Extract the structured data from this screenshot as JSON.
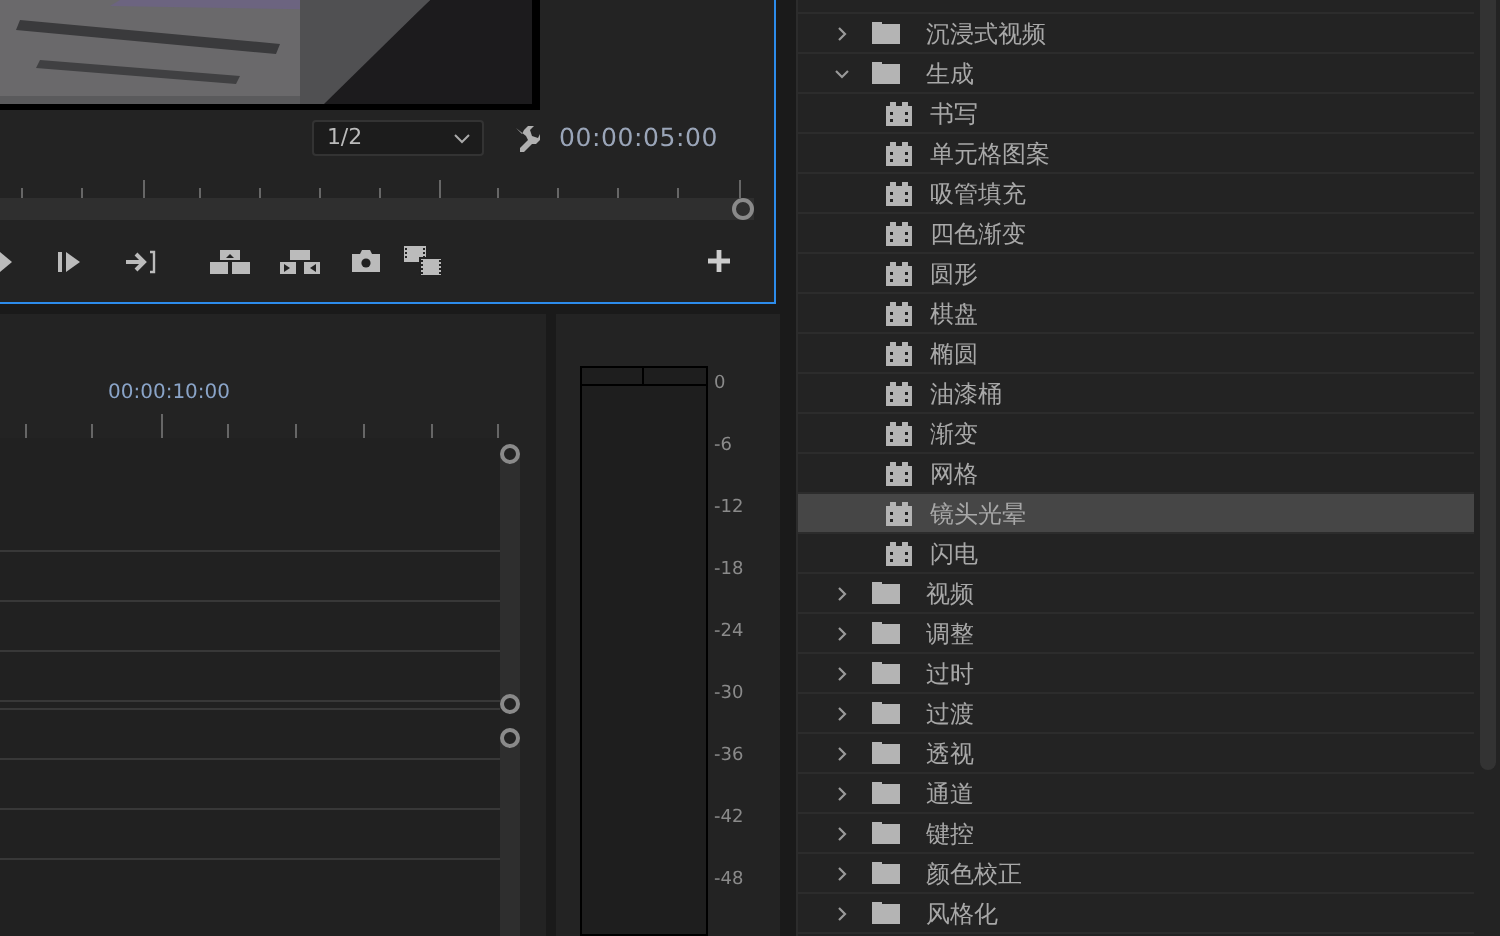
{
  "program_monitor": {
    "zoom_dropdown": "1/2",
    "timecode": "00:00:05:00",
    "scrubber": {
      "level": 1
    }
  },
  "timeline": {
    "ruler_time": "00:00:10:00"
  },
  "audio_meter": {
    "scale": [
      "0",
      "-6",
      "-12",
      "-18",
      "-24",
      "-30",
      "-36",
      "-42",
      "-48"
    ]
  },
  "effects_tree": [
    {
      "kind": "folder",
      "label": "沉浸式视频",
      "expanded": false,
      "selected": false
    },
    {
      "kind": "folder",
      "label": "生成",
      "expanded": true,
      "selected": false,
      "children": [
        {
          "kind": "effect",
          "label": "书写",
          "selected": false
        },
        {
          "kind": "effect",
          "label": "单元格图案",
          "selected": false
        },
        {
          "kind": "effect",
          "label": "吸管填充",
          "selected": false
        },
        {
          "kind": "effect",
          "label": "四色渐变",
          "selected": false
        },
        {
          "kind": "effect",
          "label": "圆形",
          "selected": false
        },
        {
          "kind": "effect",
          "label": "棋盘",
          "selected": false
        },
        {
          "kind": "effect",
          "label": "椭圆",
          "selected": false
        },
        {
          "kind": "effect",
          "label": "油漆桶",
          "selected": false
        },
        {
          "kind": "effect",
          "label": "渐变",
          "selected": false
        },
        {
          "kind": "effect",
          "label": "网格",
          "selected": false
        },
        {
          "kind": "effect",
          "label": "镜头光晕",
          "selected": true
        },
        {
          "kind": "effect",
          "label": "闪电",
          "selected": false
        }
      ]
    },
    {
      "kind": "folder",
      "label": "视频",
      "expanded": false,
      "selected": false
    },
    {
      "kind": "folder",
      "label": "调整",
      "expanded": false,
      "selected": false
    },
    {
      "kind": "folder",
      "label": "过时",
      "expanded": false,
      "selected": false
    },
    {
      "kind": "folder",
      "label": "过渡",
      "expanded": false,
      "selected": false
    },
    {
      "kind": "folder",
      "label": "透视",
      "expanded": false,
      "selected": false
    },
    {
      "kind": "folder",
      "label": "通道",
      "expanded": false,
      "selected": false
    },
    {
      "kind": "folder",
      "label": "键控",
      "expanded": false,
      "selected": false
    },
    {
      "kind": "folder",
      "label": "颜色校正",
      "expanded": false,
      "selected": false
    },
    {
      "kind": "folder",
      "label": "风格化",
      "expanded": false,
      "selected": false
    }
  ]
}
